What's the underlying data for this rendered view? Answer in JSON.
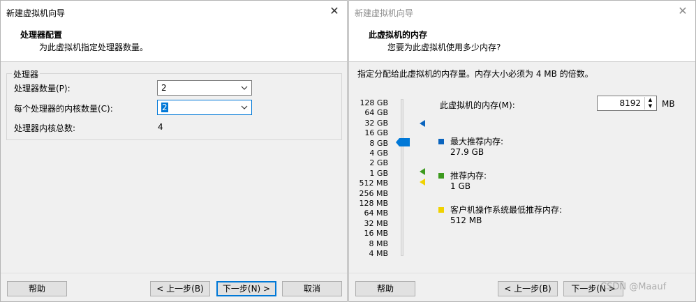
{
  "left_dialog": {
    "title": "新建虚拟机向导",
    "close_glyph": "✕",
    "header_title": "处理器配置",
    "header_subtitle": "为此虚拟机指定处理器数量。",
    "group_title": "处理器",
    "processor_count_label": "处理器数量(P):",
    "processor_count_value": "2",
    "cores_per_processor_label": "每个处理器的内核数量(C):",
    "cores_per_processor_value": "2",
    "total_cores_label": "处理器内核总数:",
    "total_cores_value": "4",
    "buttons": {
      "help": "帮助",
      "back": "< 上一步(B)",
      "next": "下一步(N) >",
      "cancel": "取消"
    }
  },
  "right_dialog": {
    "title": "新建虚拟机向导",
    "close_glyph": "✕",
    "header_title": "此虚拟机的内存",
    "header_subtitle": "您要为此虚拟机使用多少内存?",
    "intro": "指定分配给此虚拟机的内存量。内存大小必须为 4 MB 的倍数。",
    "memory_label": "此虚拟机的内存(M):",
    "memory_value": "8192",
    "memory_unit": "MB",
    "memory_scale": [
      "128 GB",
      "64 GB",
      "32 GB",
      "16 GB",
      "8 GB",
      "4 GB",
      "2 GB",
      "1 GB",
      "512 MB",
      "256 MB",
      "128 MB",
      "64 MB",
      "32 MB",
      "16 MB",
      "8 MB",
      "4 MB"
    ],
    "slider_value": "8 GB",
    "max_recommended_label": "最大推荐内存:",
    "max_recommended_value": "27.9 GB",
    "recommended_label": "推荐内存:",
    "recommended_value": "1 GB",
    "guest_min_label": "客户机操作系统最低推荐内存:",
    "guest_min_value": "512 MB",
    "colors": {
      "max_recommended": "#0a64be",
      "recommended": "#3c9a1e",
      "guest_min": "#f0d200",
      "accent": "#0078d7"
    },
    "buttons": {
      "help": "帮助",
      "back": "< 上一步(B)",
      "next": "下一步(N >"
    }
  },
  "watermark": "CSDN @Maauf"
}
